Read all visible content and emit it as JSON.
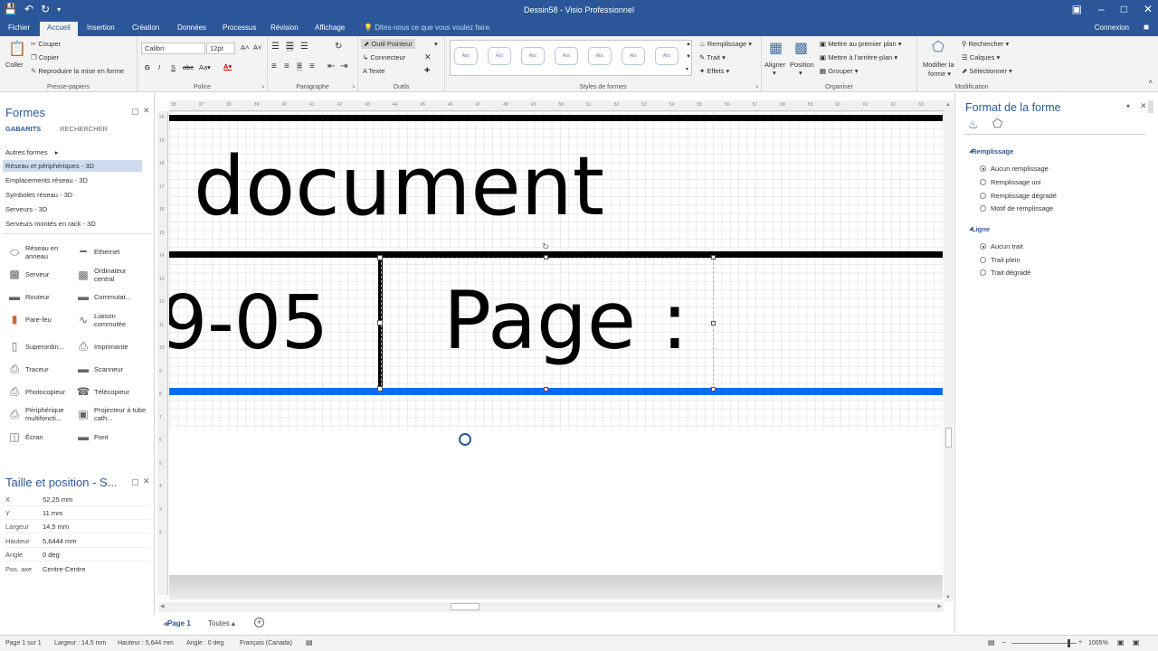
{
  "titlebar": {
    "title": "Dessin58 - Visio Professionnel"
  },
  "tabs": [
    "Fichier",
    "Accueil",
    "Insertion",
    "Création",
    "Données",
    "Processus",
    "Révision",
    "Affichage"
  ],
  "tellme": "Dites-nous ce que vous voulez faire.",
  "signin": "Connexion",
  "ribbon": {
    "clipboard": {
      "paste": "Coller",
      "cut": "Couper",
      "copy": "Copier",
      "format_painter": "Reproduire la mise en forme",
      "label": "Presse-papiers"
    },
    "font": {
      "family": "Calibri",
      "size": "12pt",
      "label": "Police",
      "bold": "G",
      "italic": "I",
      "underline": "S",
      "strike": "abc"
    },
    "paragraph": {
      "label": "Paragraphe"
    },
    "tools": {
      "pointer": "Outil Pointeur",
      "connector": "Connecteur",
      "text": "Texte",
      "label": "Outils"
    },
    "styles": {
      "thumb_label": "Abc",
      "label": "Styles de formes",
      "fill": "Remplissage",
      "line": "Trait",
      "effects": "Effets"
    },
    "arrange": {
      "align": "Aligner",
      "position": "Position",
      "front": "Mettre au premier plan",
      "back": "Mettre à l'arrière-plan",
      "group": "Grouper",
      "label": "Organiser"
    },
    "editing": {
      "change_shape_1": "Modifier la",
      "change_shape_2": "forme",
      "find": "Rechercher",
      "layers": "Calques",
      "select": "Sélectionner",
      "label": "Modification"
    }
  },
  "shapes_pane": {
    "title": "Formes",
    "tab_stencils": "GABARITS",
    "tab_search": "RECHERCHER",
    "more_shapes": "Autres formes",
    "stencils": [
      "Réseau et périphériques - 3D",
      "Emplacements réseau - 3D",
      "Symboles réseau - 3D",
      "Serveurs - 3D",
      "Serveurs montés en rack - 3D"
    ],
    "shapes": [
      [
        "Réseau en anneau",
        "Ethernet"
      ],
      [
        "Serveur",
        "Ordinateur central"
      ],
      [
        "Routeur",
        "Commutat..."
      ],
      [
        "Pare-feu",
        "Liaison commutée"
      ],
      [
        "Superordin...",
        "Imprimante"
      ],
      [
        "Traceur",
        "Scanneur"
      ],
      [
        "Photocopieur",
        "Télécopieur"
      ],
      [
        "Périphérique multifoncti...",
        "Projecteur à tube cath..."
      ],
      [
        "Écran",
        "Pont"
      ]
    ]
  },
  "size_pane": {
    "title": "Taille et position - S...",
    "rows": [
      {
        "k": "X",
        "v": "52,25 mm"
      },
      {
        "k": "Y",
        "v": "11 mm"
      },
      {
        "k": "Largeur",
        "v": "14,5 mm"
      },
      {
        "k": "Hauteur",
        "v": "5,6444 mm"
      },
      {
        "k": "Angle",
        "v": "0 deg"
      },
      {
        "k": "Pos. axe",
        "v": "Centre-Centre"
      }
    ]
  },
  "canvas": {
    "text_document": "document",
    "text_date": "9-05",
    "text_page": "Page :",
    "hruler_ticks": [
      "38",
      "37",
      "36",
      "39",
      "40",
      "41",
      "42",
      "43",
      "44",
      "45",
      "46",
      "47",
      "48",
      "49",
      "50",
      "51",
      "52",
      "53",
      "54",
      "55",
      "56",
      "57",
      "58",
      "59",
      "60",
      "61",
      "62",
      "63",
      "64"
    ],
    "vruler_ticks": [
      "20",
      "19",
      "18",
      "17",
      "16",
      "15",
      "14",
      "13",
      "12",
      "11",
      "10",
      "9",
      "8",
      "7",
      "6",
      "5",
      "4",
      "3",
      "2"
    ]
  },
  "format_pane": {
    "title": "Format de la forme",
    "fill_section": "Remplissage",
    "fill_options": [
      "Aucun remplissage",
      "Remplissage uni",
      "Remplissage dégradé",
      "Motif de remplissage"
    ],
    "line_section": "Ligne",
    "line_options": [
      "Aucun trait",
      "Trait plein",
      "Trait dégradé"
    ]
  },
  "pagetabs": {
    "page": "Page 1",
    "all": "Toutes"
  },
  "statusbar": {
    "page": "Page 1 sur 1",
    "width": "Largeur : 14,5 mm",
    "height": "Hauteur : 5,644 mm",
    "angle": "Angle : 0 deg",
    "lang": "Français (Canada)",
    "zoom": "1005%"
  },
  "colors": {
    "brand": "#2b579a",
    "connector_blue": "#0a6cf5"
  }
}
